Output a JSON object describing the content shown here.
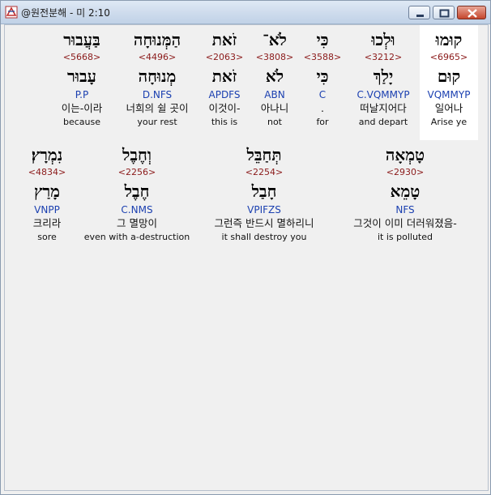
{
  "window": {
    "title": "@원전분해 - 미 2:10"
  },
  "rows": [
    [
      {
        "hebrew": "קוּמוּ",
        "strong": "<6965>",
        "lemma": "קוּם",
        "morph": "VQMMYP",
        "korean": "일어나",
        "english": "Arise ye"
      },
      {
        "hebrew": "וּלְכוּ",
        "strong": "<3212>",
        "lemma": "יָלַךְ",
        "morph": "C.VQMMYP",
        "korean": "떠날지어다",
        "english": "and depart"
      },
      {
        "hebrew": "כִּי",
        "strong": "<3588>",
        "lemma": "כִּי",
        "morph": "C",
        "korean": ".",
        "english": "for"
      },
      {
        "hebrew": "לֹא־",
        "strong": "<3808>",
        "lemma": "לֹא",
        "morph": "ABN",
        "korean": "아나니",
        "english": "not"
      },
      {
        "hebrew": "זֹאת",
        "strong": "<2063>",
        "lemma": "זֹאת",
        "morph": "APDFS",
        "korean": "이것이-",
        "english": "this is"
      },
      {
        "hebrew": "הַמְּנוּחָה",
        "strong": "<4496>",
        "lemma": "מְנוּחָה",
        "morph": "D.NFS",
        "korean": "너희의 쉴 곳이",
        "english": "your rest"
      },
      {
        "hebrew": "בַּעֲבוּר",
        "strong": "<5668>",
        "lemma": "עָבוּר",
        "morph": "P.P",
        "korean": "이는-이라",
        "english": "because"
      }
    ],
    [
      {
        "hebrew": "טָמְאָה",
        "strong": "<2930>",
        "lemma": "טָמֵא",
        "morph": "NFS",
        "korean": "그것이 이미 더러워졌음-",
        "english": "it is polluted"
      },
      {
        "hebrew": "תְּחַבֵּל",
        "strong": "<2254>",
        "lemma": "חָבַל",
        "morph": "VPIFZS",
        "korean": "그런즉 반드시 멸하리니",
        "english": "it shall destroy you"
      },
      {
        "hebrew": "וְחֶבֶל",
        "strong": "<2256>",
        "lemma": "חֶבֶל",
        "morph": "C.NMS",
        "korean": "그 멸망이",
        "english": "even with a-destruction"
      },
      {
        "hebrew": "נִמְרָץ׃",
        "strong": "<4834>",
        "lemma": "מָרַץ",
        "morph": "VNPP",
        "korean": "크리라",
        "english": "sore"
      }
    ]
  ]
}
